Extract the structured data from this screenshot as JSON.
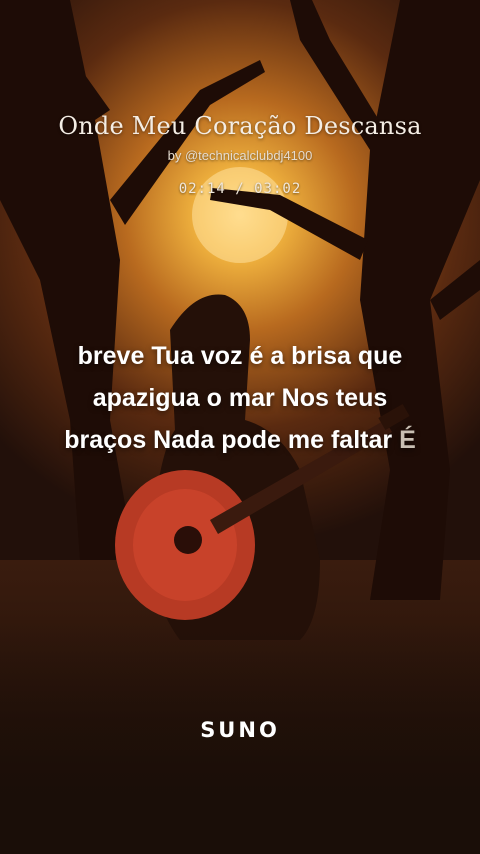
{
  "song": {
    "title": "Onde Meu Coração Descansa",
    "byline": "by @technicalclubdj4100",
    "time": "02:14 / 03:02"
  },
  "lyrics": {
    "line1": "breve Tua voz é a brisa que",
    "line2": "apazigua o mar Nos teus",
    "line3_main": "braços Nada pode me faltar",
    "line3_next": "É"
  },
  "brand": {
    "label": "SUNO"
  },
  "colors": {
    "sun": "#f3b640",
    "sky_dark": "#2a1208",
    "guitar": "#c8422a",
    "text": "#ffffff"
  }
}
